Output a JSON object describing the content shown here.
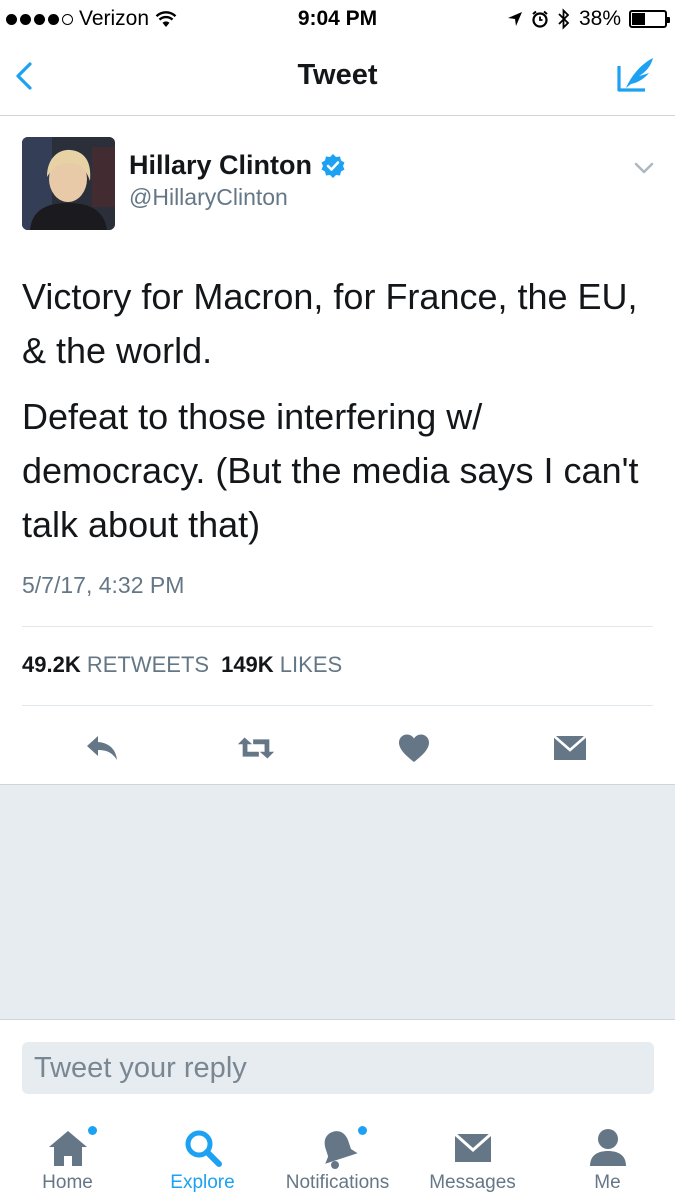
{
  "status_bar": {
    "carrier": "Verizon",
    "time": "9:04 PM",
    "battery": "38%",
    "battery_level": 0.38
  },
  "nav": {
    "title": "Tweet",
    "back_icon": "chevron-left-icon",
    "compose_icon": "compose-tweet-icon"
  },
  "tweet": {
    "author_name": "Hillary Clinton",
    "author_handle": "@HillaryClinton",
    "verified": true,
    "paragraph1": "Victory for Macron, for France, the EU, & the world.",
    "paragraph2": "Defeat to those interfering w/ democracy. (But the media says I can't talk about that)",
    "timestamp": "5/7/17, 4:32 PM",
    "retweets_count": "49.2K",
    "retweets_label": "RETWEETS",
    "likes_count": "149K",
    "likes_label": "LIKES"
  },
  "reply": {
    "placeholder": "Tweet your reply"
  },
  "tabbar": {
    "home": "Home",
    "explore": "Explore",
    "notifications": "Notifications",
    "messages": "Messages",
    "me": "Me"
  },
  "colors": {
    "accent": "#1da1f2",
    "text": "#14171a",
    "secondary": "#657786",
    "gray_bg": "#e6ecf0"
  }
}
